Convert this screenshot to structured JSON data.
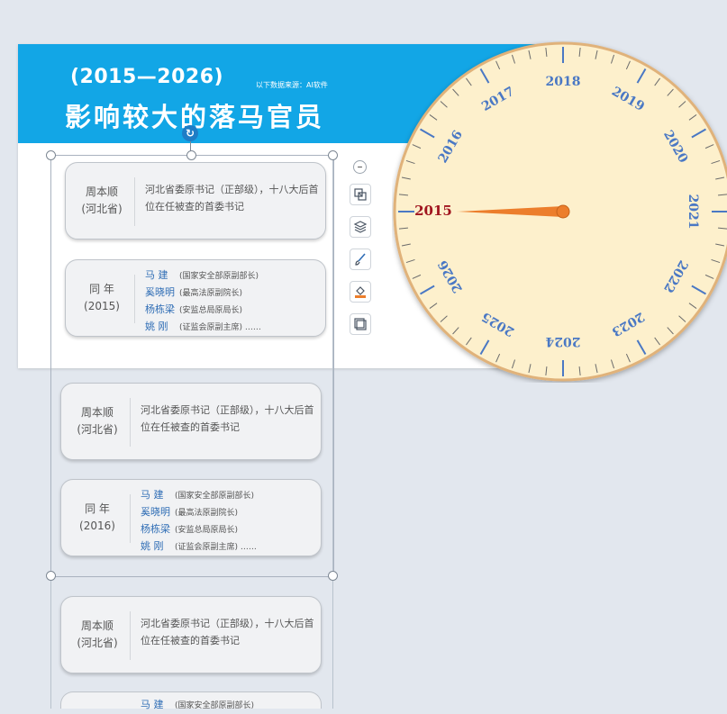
{
  "header": {
    "years": "(2015—2026)",
    "source": "以下数据来源：AI软件",
    "title": "影响较大的落马官员"
  },
  "cards": [
    {
      "type": "person",
      "name": "周本顺",
      "region": "(河北省)",
      "desc": "河北省委原书记（正部级），十八大后首位在任被查的首委书记"
    },
    {
      "type": "list",
      "label": "同  年",
      "year": "(2015)",
      "items": [
        {
          "name": "马  建",
          "role": "(国家安全部原副部长)"
        },
        {
          "name": "奚晓明",
          "role": "(最高法原副院长)"
        },
        {
          "name": "杨栋梁",
          "role": "(安监总局原局长)"
        },
        {
          "name": "姚  刚",
          "role": "(证监会原副主席) ……"
        }
      ]
    },
    {
      "type": "person",
      "name": "周本顺",
      "region": "(河北省)",
      "desc": "河北省委原书记（正部级），十八大后首位在任被查的首委书记"
    },
    {
      "type": "list",
      "label": "同  年",
      "year": "(2016)",
      "items": [
        {
          "name": "马  建",
          "role": "(国家安全部原副部长)"
        },
        {
          "name": "奚晓明",
          "role": "(最高法原副院长)"
        },
        {
          "name": "杨栋梁",
          "role": "(安监总局原局长)"
        },
        {
          "name": "姚  刚",
          "role": "(证监会原副主席) ……"
        }
      ]
    },
    {
      "type": "person",
      "name": "周本顺",
      "region": "(河北省)",
      "desc": "河北省委原书记（正部级），十八大后首位在任被查的首委书记"
    },
    {
      "type": "list",
      "label": "",
      "year": "",
      "items": [
        {
          "name": "马  建",
          "role": "(国家安全部原副部长)"
        }
      ]
    }
  ],
  "toolbar": {
    "collapse_icon": "minus-icon",
    "tools": [
      "crop-icon",
      "layers-icon",
      "brush-icon",
      "fill-icon",
      "frame-icon"
    ]
  },
  "dial": {
    "years": [
      "2015",
      "2016",
      "2017",
      "2018",
      "2019",
      "2020",
      "2021",
      "2022",
      "2023",
      "2024",
      "2025",
      "2026"
    ],
    "selected": "2015",
    "colors": {
      "face": "#fdf0cc",
      "border": "#e0b27a",
      "label": "#4a78c4",
      "selected": "#a0141e",
      "needle": "#ec7e2c"
    }
  }
}
